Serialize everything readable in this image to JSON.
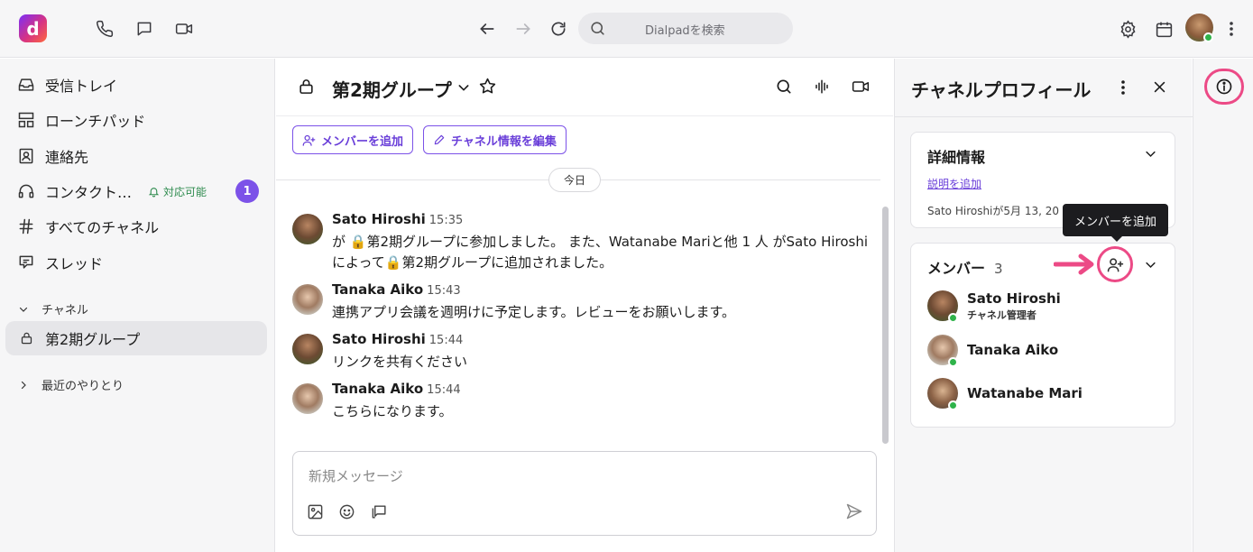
{
  "topbar": {
    "logo_letter": "d",
    "search_placeholder": "Dialpadを検索"
  },
  "sidebar": {
    "items": [
      {
        "label": "受信トレイ"
      },
      {
        "label": "ローンチパッド"
      },
      {
        "label": "連絡先"
      },
      {
        "label": "コンタクト…",
        "status": "対応可能",
        "badge": "1"
      },
      {
        "label": "すべてのチャネル"
      },
      {
        "label": "スレッド"
      }
    ],
    "channels_header": "チャネル",
    "channels": [
      {
        "label": "第2期グループ"
      }
    ],
    "recent_header": "最近のやりとり"
  },
  "channel": {
    "title": "第2期グループ",
    "add_member_button": "メンバーを追加",
    "edit_info_button": "チャネル情報を編集",
    "date_divider": "今日",
    "messages": [
      {
        "name": "Sato Hiroshi",
        "time": "15:35",
        "body": "が 🔒第2期グループに参加しました。 また、Watanabe Mariと他 1 人 がSato Hiroshiによって🔒第2期グループに追加されました。"
      },
      {
        "name": "Tanaka Aiko",
        "time": "15:43",
        "body": "連携アプリ会議を週明けに予定します。レビューをお願いします。"
      },
      {
        "name": "Sato Hiroshi",
        "time": "15:44",
        "body": "リンクを共有ください"
      },
      {
        "name": "Tanaka Aiko",
        "time": "15:44",
        "body": "こちらになります。"
      }
    ],
    "composer_placeholder": "新規メッセージ"
  },
  "profile": {
    "title": "チャネルプロフィール",
    "details": {
      "title": "詳細情報",
      "add_description": "説明を追加",
      "created": "Sato Hiroshiが5月 13, 20"
    },
    "tooltip": "メンバーを追加",
    "members": {
      "title": "メンバー",
      "count": "3",
      "list": [
        {
          "name": "Sato Hiroshi",
          "role": "チャネル管理者"
        },
        {
          "name": "Tanaka Aiko",
          "role": ""
        },
        {
          "name": "Watanabe Mari",
          "role": ""
        }
      ]
    }
  },
  "colors": {
    "accent": "#7c52e8",
    "highlight": "#ec4a86",
    "online": "#2fb34a"
  }
}
